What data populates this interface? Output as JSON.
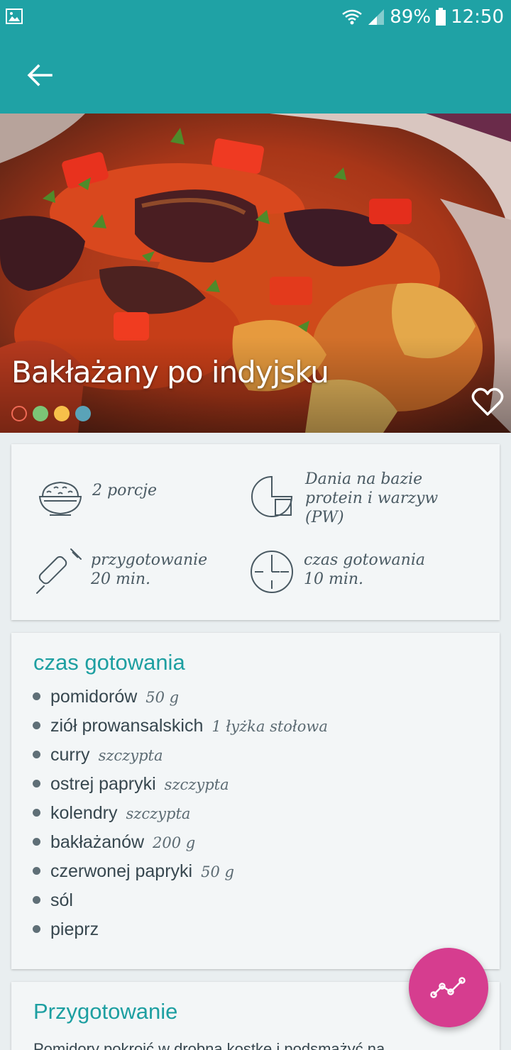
{
  "status_bar": {
    "battery": "89%",
    "time": "12:50"
  },
  "recipe": {
    "title": "Bakłażany po indyjsku",
    "slide_dot_colors": [
      "#f06a55",
      "#7cc576",
      "#f7c04a",
      "#5aa3b8"
    ]
  },
  "info": {
    "servings": "2 porcje",
    "category": "Dania na bazie\nprotein i warzyw\n(PW)",
    "prep_time": "przygotowanie\n20 min.",
    "cook_time": "czas gotowania\n10 min."
  },
  "ingredients": {
    "title": "czas gotowania",
    "items": [
      {
        "name": "pomidorów",
        "qty": "50 g"
      },
      {
        "name": "ziół prowansalskich",
        "qty": "1 łyżka stołowa"
      },
      {
        "name": "curry",
        "qty": "szczypta"
      },
      {
        "name": "ostrej papryki",
        "qty": "szczypta"
      },
      {
        "name": "kolendry",
        "qty": "szczypta"
      },
      {
        "name": "bakłażanów",
        "qty": "200 g"
      },
      {
        "name": "czerwonej papryki",
        "qty": "50 g"
      },
      {
        "name": "sól",
        "qty": ""
      },
      {
        "name": "pieprz",
        "qty": ""
      }
    ]
  },
  "preparation": {
    "title": "Przygotowanie",
    "text": "Pomidory pokroić w drobną kostkę i podsmażyć na"
  },
  "colors": {
    "primary": "#1fa2a5",
    "accent": "#d63d8f",
    "section_title": "#1d9fa1"
  },
  "icons": {
    "back": "arrow-left-icon",
    "favorite": "heart-outline-icon",
    "fab": "line-chart-icon"
  }
}
